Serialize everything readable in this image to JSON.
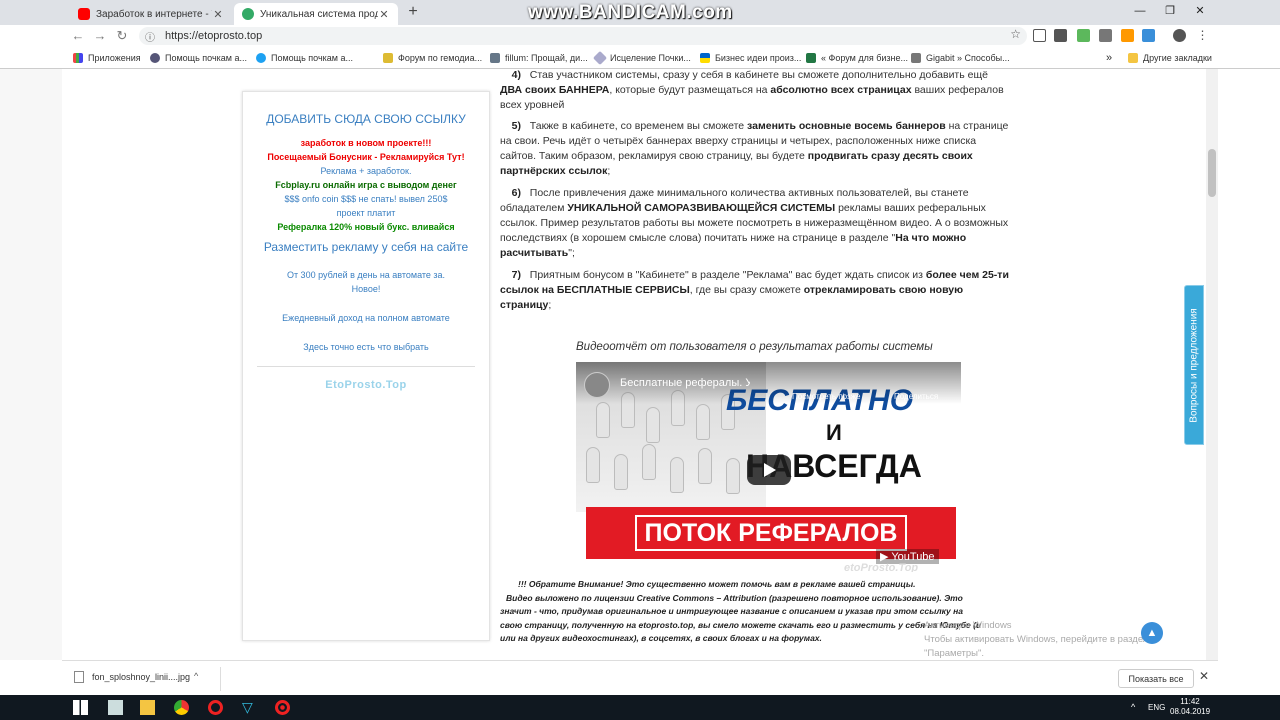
{
  "browser": {
    "tabs": [
      {
        "title": "Заработок в интернете - YouTube"
      },
      {
        "title": "Уникальная система продвижения"
      }
    ],
    "url": "https://etoprosto.top",
    "bookmarks": [
      {
        "label": "Приложения"
      },
      {
        "label": "Помощь почкам а..."
      },
      {
        "label": "Помощь почкам а..."
      },
      {
        "label": "Форум по гемодиа..."
      },
      {
        "label": "fillum: Прощай, ди..."
      },
      {
        "label": "Исцеление Почки..."
      },
      {
        "label": "Бизнес идеи произ..."
      },
      {
        "label": "« Форум для бизне..."
      },
      {
        "label": "Gigabit » Способы..."
      }
    ],
    "other_bookmarks": "Другие закладки",
    "overflow": "»"
  },
  "watermark": "www.BANDICAM.com",
  "sidebar": {
    "title": "ДОБАВИТЬ СЮДА СВОЮ ССЫЛКУ",
    "links": [
      "заработок в новом проекте!!!",
      "Посещаемый Бонусник - Рекламируйся Тут!",
      "Реклама + заработок.",
      "Fcbplay.ru онлайн игра с выводом денег",
      "$$$ onfo coin $$$ не спать! вывел 250$",
      "проект платит",
      "Рефералка 120% новый букс. вливайся"
    ],
    "big_link": "Разместить рекламу у себя на сайте",
    "promo": [
      "От 300 рублей в день на автомате за.",
      "Новое!",
      "Ежедневный доход на полном автомате",
      "Здесь точно есть что выбрать"
    ],
    "logo": "EtoProsto.Top"
  },
  "content": {
    "p4": {
      "num": "4)",
      "t1": "Став участником системы, сразу у себя в кабинете вы сможете дополнительно добавить ещё",
      "b1": "ДВА своих БАННЕРА",
      "t2": ", которые будут размещаться на",
      "b2": "абсолютно всех страницах",
      "t3": "ваших рефералов",
      "t4": "всех уровней"
    },
    "p5": {
      "num": "5)",
      "t1": "Также в кабинете, со временем вы сможете",
      "b1": "заменить основные восемь баннеров",
      "t2": "на странице",
      "t3": "на свои. Речь идёт о четырёх баннерах вверху страницы и четырех, расположенных ниже списка",
      "t4": "сайтов. Таким образом, рекламируя свою страницу, вы будете",
      "b2": "продвигать сразу десять своих",
      "b3": "партнёрских ссылок",
      "t5": ";"
    },
    "p6": {
      "num": "6)",
      "t1": "После привлечения даже минимального количества активных пользователей, вы станете",
      "t2": "обладателем",
      "b1": "УНИКАЛЬНОЙ САМОРАЗВИВАЮЩЕЙСЯ СИСТЕМЫ",
      "t3": "рекламы ваших реферальных",
      "t4": "ссылок. Пример результатов работы вы можете посмотреть в нижеразмещённом видео. А о возможных",
      "t5": "последствиях (в хорошем смысле слова) почитать ниже на странице в разделе \"",
      "b2": "На что можно",
      "b3": "расчитывать",
      "t6": "\";"
    },
    "p7": {
      "num": "7)",
      "t1": "Приятным бонусом в \"Кабинете\" в разделе \"Реклама\" вас будет ждать список из",
      "b1": "более чем 25-ти",
      "b2": "ссылок на БЕСПЛАТНЫЕ СЕРВИСЫ",
      "t2": ", где вы сразу сможете",
      "b3": "отрекламировать свою новую",
      "b4": "страницу",
      "t3": ";"
    },
    "video_caption": "Видеоотчёт от пользователя о результатах работы системы",
    "video": {
      "title": "Бесплатные рефералы. Ун...",
      "watch_later": "Посмотреть позже",
      "share": "Поделиться",
      "line1": "БЕСПЛАТНО",
      "line2": "И",
      "line3": "НАВСЕГДА",
      "banner": "ПОТОК РЕФЕРАЛОВ",
      "youtube": "▶ YouTube",
      "site": "etoProsto.Top"
    },
    "note": [
      "!!! Обратите Внимание!    Это существенно может помочь вам в рекламе вашей страницы.",
      "Видео выложено по лицензии Creative Commons – Attribution (разрешено повторное использование). Это",
      "значит - что, придумав оригинальное и интригующее название с описанием и указав при этом ссылку на",
      "свою страницу, полученную на etoprosto.top, вы смело можете скачать его и разместить у себя на Ютубе (и",
      "или на других видеохостингах), в соцсетях, в своих блогах и на форумах."
    ]
  },
  "feedback": "Вопросы и предложения",
  "windows_activation": [
    "Активация Windows",
    "Чтобы активировать Windows, перейдите в раздел",
    "\"Параметры\"."
  ],
  "downloads": {
    "file": "fon_sploshnoy_linii....jpg",
    "show_all": "Показать все"
  },
  "taskbar": {
    "lang": "ENG",
    "time": "11:42",
    "date": "08.04.2019"
  },
  "colors": {
    "link_blue": "#3a7fc1",
    "red": "#e00000",
    "green": "#0a8a00",
    "banner_red": "#e21b24",
    "feedback_blue": "#3aa9d9"
  }
}
